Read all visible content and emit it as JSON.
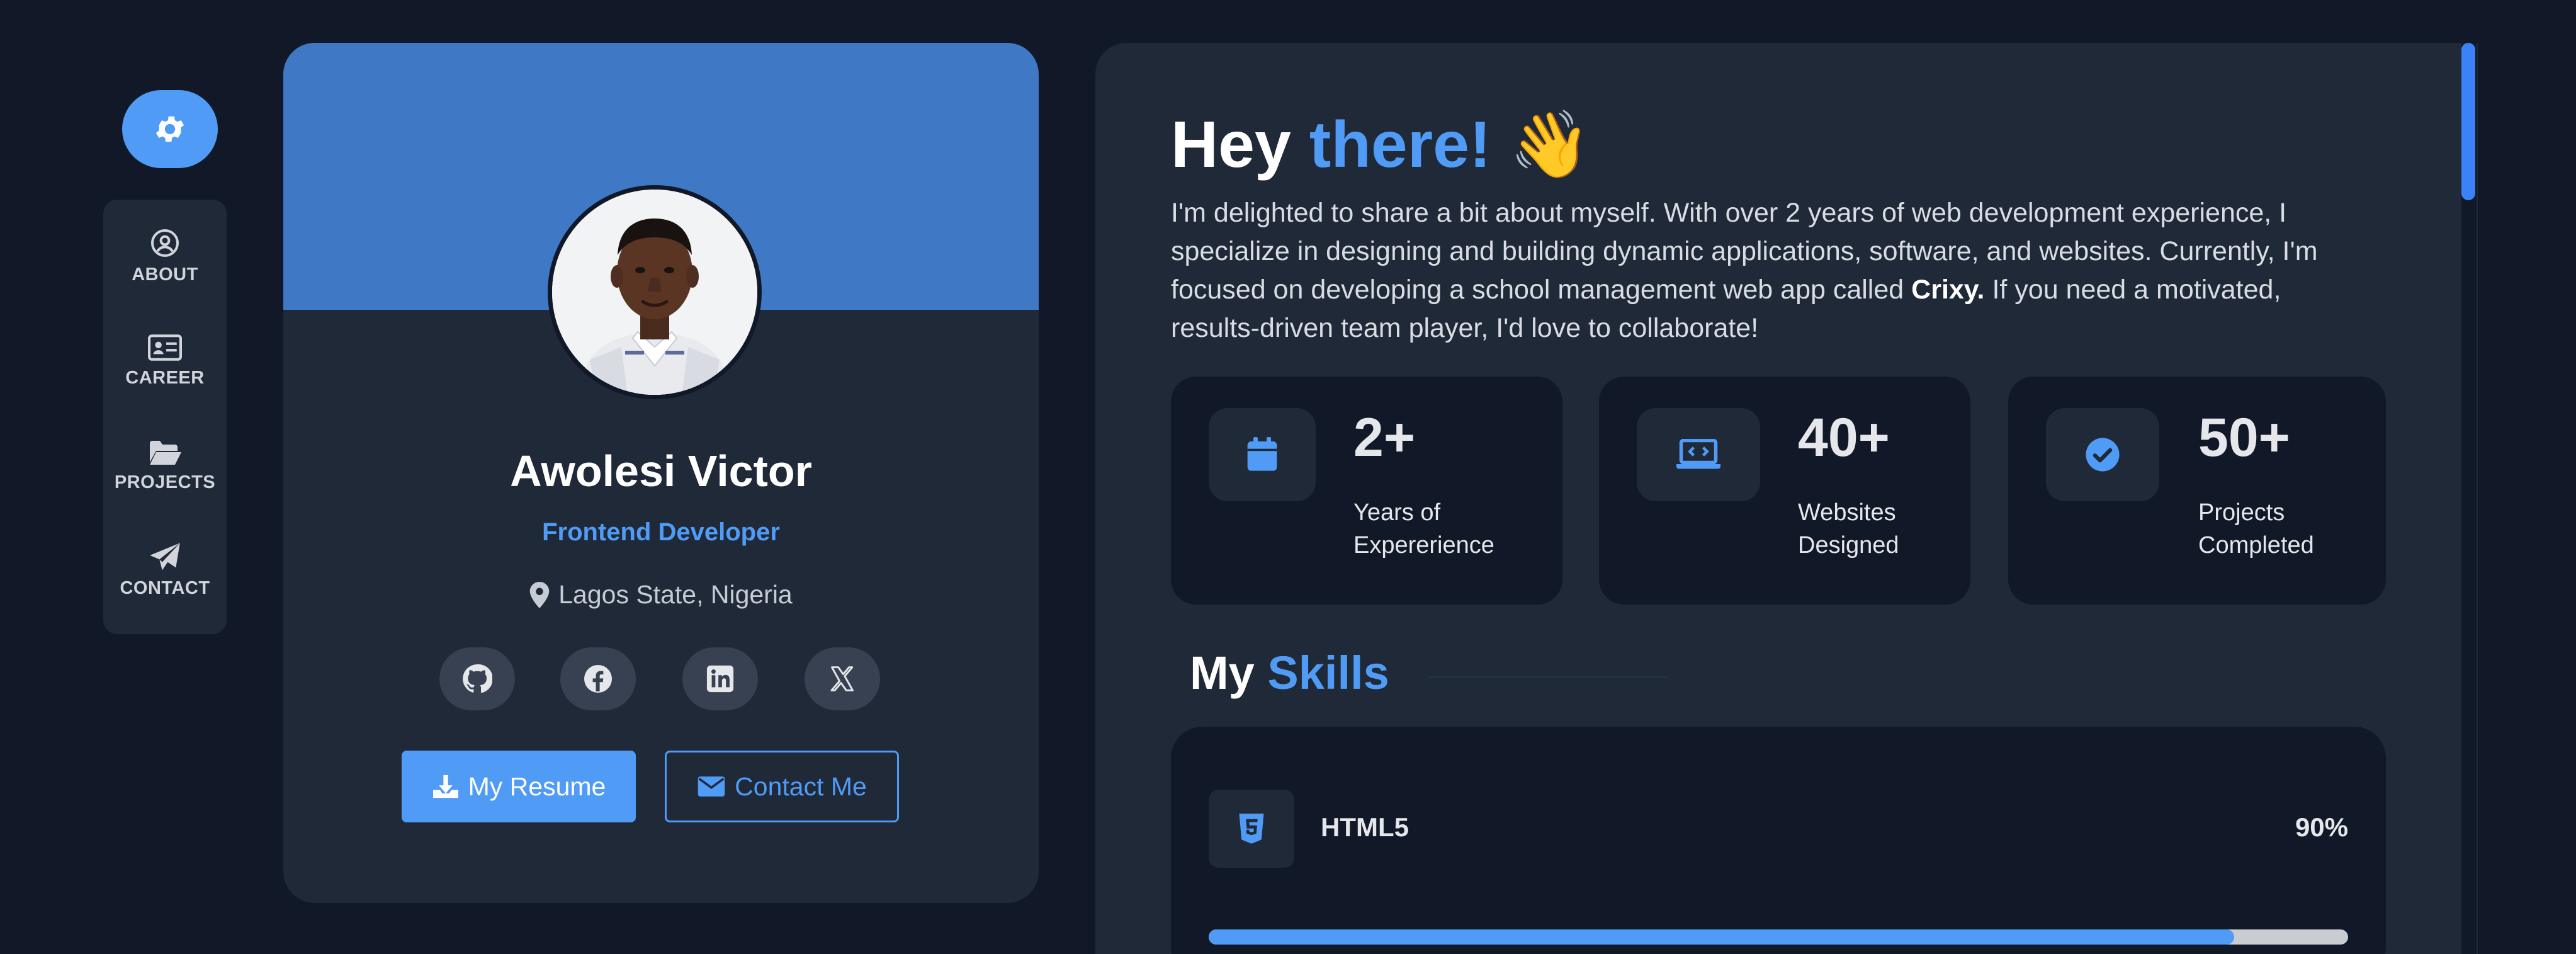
{
  "colors": {
    "accent": "#4f9bf6",
    "background": "#111827",
    "card": "#1f2937",
    "banner": "#3f78c5"
  },
  "settings": {
    "icon": "gear-icon"
  },
  "nav": {
    "items": [
      {
        "label": "ABOUT",
        "icon": "user-circle-icon"
      },
      {
        "label": "CAREER",
        "icon": "id-card-icon"
      },
      {
        "label": "PROJECTS",
        "icon": "folder-open-icon"
      },
      {
        "label": "CONTACT",
        "icon": "paper-plane-icon"
      }
    ]
  },
  "profile": {
    "name": "Awolesi Victor",
    "role": "Frontend Developer",
    "location": "Lagos State, Nigeria",
    "socials": [
      {
        "icon": "github-icon"
      },
      {
        "icon": "facebook-icon"
      },
      {
        "icon": "linkedin-icon"
      },
      {
        "icon": "x-twitter-icon"
      }
    ],
    "resume_label": "My Resume",
    "contact_label": "Contact Me"
  },
  "about": {
    "greeting": "Hey",
    "greeting_accent": "there!",
    "wave": "👋",
    "intro_before": "I'm delighted to share a bit about myself. With over 2 years of web development experience, I specialize in designing and building dynamic applications, software, and websites. Currently, I'm focused on developing a school management web app called",
    "intro_bold": "Crixy.",
    "intro_after": "If you need a motivated, results-driven team player, I'd love to collaborate!"
  },
  "stats": [
    {
      "value": "2+",
      "line1": "Years of",
      "line2": "Expererience",
      "icon": "calendar-icon"
    },
    {
      "value": "40+",
      "line1": "Websites",
      "line2": "Designed",
      "icon": "laptop-code-icon"
    },
    {
      "value": "50+",
      "line1": "Projects",
      "line2": "Completed",
      "icon": "check-circle-icon"
    }
  ],
  "skills": {
    "title": "My",
    "title_accent": "Skills",
    "items": [
      {
        "name": "HTML5",
        "percent_label": "90%",
        "percent": 90,
        "icon": "html5-icon"
      }
    ]
  }
}
